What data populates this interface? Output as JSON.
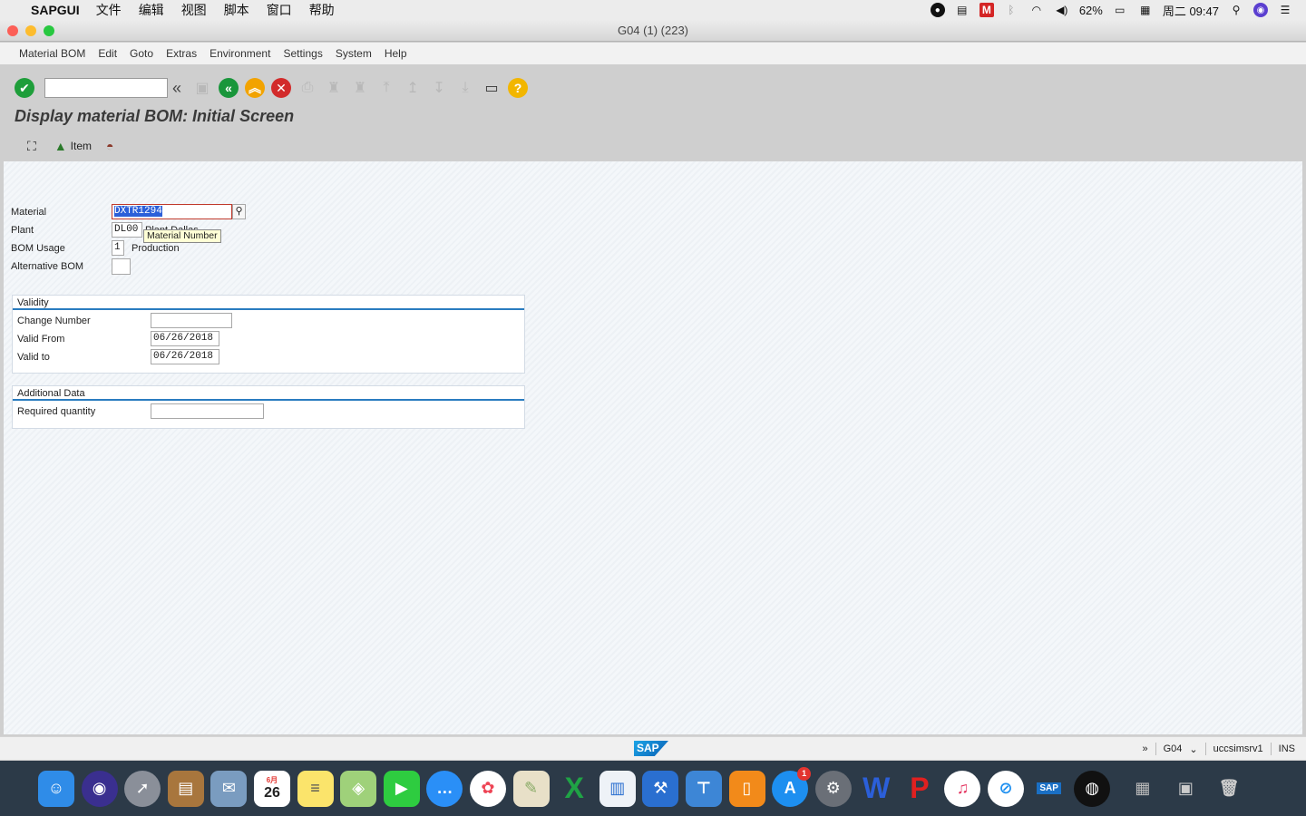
{
  "os_menubar": {
    "app_name": "SAPGUI",
    "menus": [
      "文件",
      "编辑",
      "视图",
      "脚本",
      "窗口",
      "帮助"
    ],
    "battery": "62%",
    "clock": "周二 09:47"
  },
  "window": {
    "title": "G04 (1) (223)"
  },
  "sap_menu": [
    "Material BOM",
    "Edit",
    "Goto",
    "Extras",
    "Environment",
    "Settings",
    "System",
    "Help"
  ],
  "toolbar": {
    "command_field_value": ""
  },
  "page_title": "Display material BOM: Initial Screen",
  "app_toolbar": {
    "item_label": "Item"
  },
  "form": {
    "material_label": "Material",
    "material_value": "DXTR1294",
    "plant_label": "Plant",
    "plant_value": "DL00",
    "plant_text": "Plant Dallas",
    "bom_usage_label": "BOM Usage",
    "bom_usage_value": "1",
    "bom_usage_text": "Production",
    "alt_bom_label": "Alternative BOM",
    "alt_bom_value": "",
    "tooltip": "Material Number"
  },
  "validity": {
    "title": "Validity",
    "change_number_label": "Change Number",
    "change_number_value": "",
    "valid_from_label": "Valid From",
    "valid_from_value": "06/26/2018",
    "valid_to_label": "Valid to",
    "valid_to_value": "06/26/2018"
  },
  "additional": {
    "title": "Additional Data",
    "required_qty_label": "Required quantity",
    "required_qty_value": ""
  },
  "status_bar": {
    "logo_text": "SAP",
    "arrows": "»",
    "system": "G04",
    "server": "uccsimsrv1",
    "mode": "INS"
  },
  "dock": {
    "calendar_month": "6月",
    "calendar_day": "26",
    "appstore_badge": "1",
    "sap_label": "SAP"
  },
  "colors": {
    "accent_blue": "#2a7cc0",
    "selection": "#2b5fd9",
    "ok_green": "#1e9e3a"
  }
}
